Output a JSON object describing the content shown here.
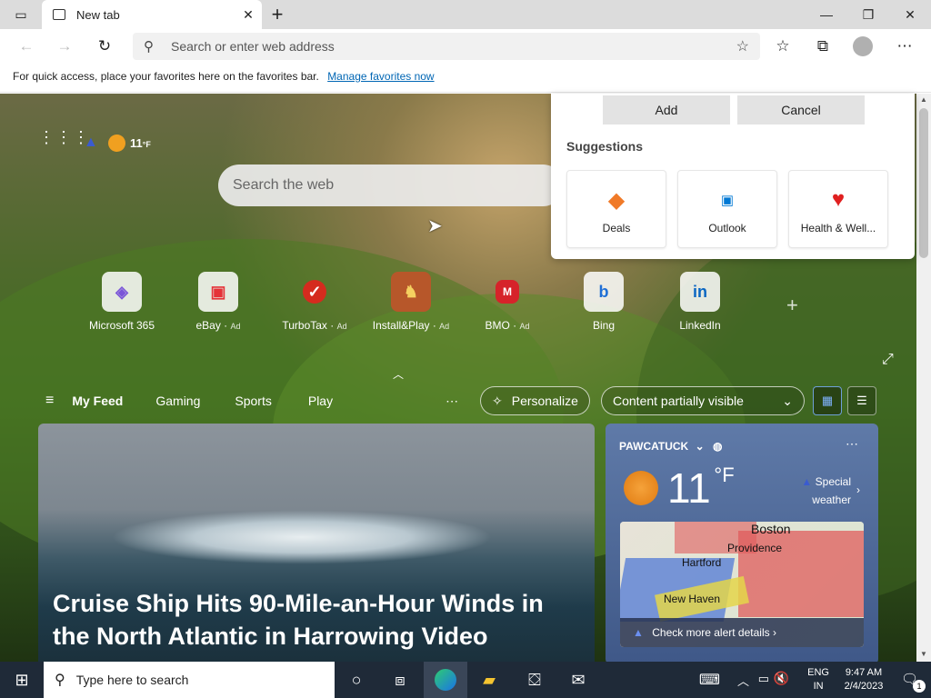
{
  "browser": {
    "tab_title": "New tab",
    "address_placeholder": "Search or enter web address",
    "favorites_bar_text": "For quick access, place your favorites here on the favorites bar.",
    "favorites_bar_link": "Manage favorites now"
  },
  "popup": {
    "add_label": "Add",
    "cancel_label": "Cancel",
    "suggestions_heading": "Suggestions",
    "suggestions": [
      {
        "label": "Deals",
        "icon": "diamond-icon"
      },
      {
        "label": "Outlook",
        "icon": "outlook-icon"
      },
      {
        "label": "Health & Well...",
        "icon": "heart-icon"
      }
    ]
  },
  "newtab": {
    "weather_temp": "11",
    "weather_unit": "°F",
    "search_placeholder": "Search the web",
    "tiles": [
      {
        "label": "Microsoft 365",
        "ad": ""
      },
      {
        "label": "eBay",
        "ad": "Ad"
      },
      {
        "label": "TurboTax",
        "ad": "Ad"
      },
      {
        "label": "Install&Play",
        "ad": "Ad"
      },
      {
        "label": "BMO",
        "ad": "Ad"
      },
      {
        "label": "Bing",
        "ad": ""
      },
      {
        "label": "LinkedIn",
        "ad": ""
      }
    ],
    "feed_tabs": [
      "My Feed",
      "Gaming",
      "Sports",
      "Play"
    ],
    "personalize_label": "Personalize",
    "content_visibility": "Content partially visible",
    "news_headline": "Cruise Ship Hits 90-Mile-an-Hour Winds in the North Atlantic in Harrowing Video",
    "weather_card": {
      "location": "PAWCATUCK",
      "temp": "11",
      "unit": "°F",
      "alert_line1": "Special",
      "alert_line2": "weather",
      "map_labels": [
        "Boston",
        "Providence",
        "Hartford",
        "New Haven"
      ],
      "alert_link": "Check more alert details"
    }
  },
  "taskbar": {
    "search_placeholder": "Type here to search",
    "language_line1": "ENG",
    "language_line2": "IN",
    "time": "9:47 AM",
    "date": "2/4/2023",
    "notification_count": "1"
  }
}
